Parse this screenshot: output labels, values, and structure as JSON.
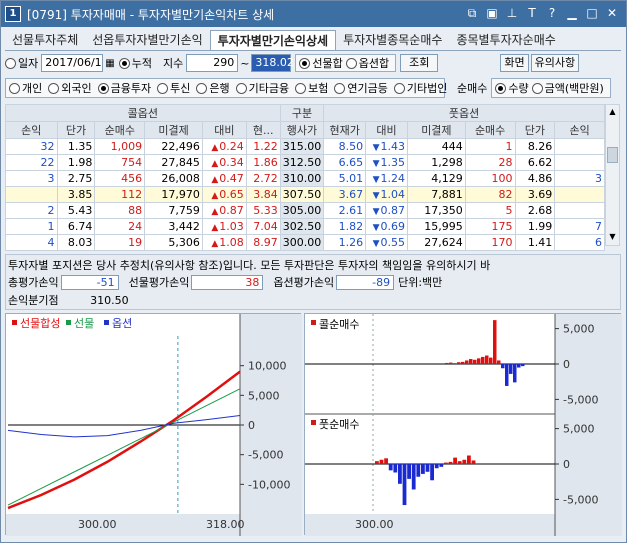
{
  "window": {
    "number": "1",
    "title": "[0791] 투자자매매 - 투자자별만기손익차트 상세"
  },
  "tabs": [
    "선물투자주체",
    "선옵투자자별만기손익",
    "투자자별만기손익상세",
    "투자자별종목순매수",
    "종목별투자자순매수"
  ],
  "active_tab": 2,
  "controls": {
    "date_label": "일자",
    "date_value": "2017/06/1",
    "cum_label": "누적",
    "index_label": "지수",
    "index_from": "290",
    "tilde": "~",
    "index_to": "318.02",
    "opt_sum": "선물합",
    "opt_option": "옵션합",
    "query_button": "조회",
    "screen_button": "화면",
    "caution_button": "유의사항"
  },
  "investors": [
    "개인",
    "외국인",
    "금융투자",
    "투신",
    "은행",
    "기타금융",
    "보험",
    "연기금등",
    "기타법인"
  ],
  "investor_selected": 2,
  "net_buy_label": "순매수",
  "net_options": [
    "수량",
    "금액(백만원)"
  ],
  "table": {
    "group_call": "콜옵션",
    "group_mid": "구분",
    "group_put": "풋옵션",
    "headers": [
      "손익",
      "단가",
      "순매수",
      "미결제",
      "대비",
      "현...",
      "행사가",
      "현재가",
      "대비",
      "미결제",
      "순매수",
      "단가",
      "손익"
    ],
    "rows": [
      {
        "c_pl": "32",
        "c_price": "1.35",
        "c_net": "1,009",
        "c_oi": "22,496",
        "c_chg": "0.24",
        "c_chgdir": "up",
        "c_cur": "1.22",
        "strike": "315.00",
        "p_cur": "8.50",
        "p_chg": "1.43",
        "p_chgdir": "dn",
        "p_oi": "444",
        "p_net": "1",
        "p_price": "8.26",
        "p_pl": ""
      },
      {
        "c_pl": "22",
        "c_price": "1.98",
        "c_net": "754",
        "c_oi": "27,845",
        "c_chg": "0.34",
        "c_chgdir": "up",
        "c_cur": "1.86",
        "strike": "312.50",
        "p_cur": "6.65",
        "p_chg": "1.35",
        "p_chgdir": "dn",
        "p_oi": "1,298",
        "p_net": "28",
        "p_price": "6.62",
        "p_pl": ""
      },
      {
        "c_pl": "3",
        "c_price": "2.75",
        "c_net": "456",
        "c_oi": "26,008",
        "c_chg": "0.47",
        "c_chgdir": "up",
        "c_cur": "2.72",
        "strike": "310.00",
        "p_cur": "5.01",
        "p_chg": "1.24",
        "p_chgdir": "dn",
        "p_oi": "4,129",
        "p_net": "100",
        "p_price": "4.86",
        "p_pl": "3"
      },
      {
        "c_pl": "",
        "c_price": "3.85",
        "c_net": "112",
        "c_oi": "17,970",
        "c_chg": "0.65",
        "c_chgdir": "up",
        "c_cur": "3.84",
        "strike": "307.50",
        "p_cur": "3.67",
        "p_chg": "1.04",
        "p_chgdir": "dn",
        "p_oi": "7,881",
        "p_net": "82",
        "p_price": "3.69",
        "p_pl": "",
        "hl": true
      },
      {
        "c_pl": "2",
        "c_price": "5.43",
        "c_net": "88",
        "c_oi": "7,759",
        "c_chg": "0.87",
        "c_chgdir": "up",
        "c_cur": "5.33",
        "strike": "305.00",
        "p_cur": "2.61",
        "p_chg": "0.87",
        "p_chgdir": "dn",
        "p_oi": "17,350",
        "p_net": "5",
        "p_price": "2.68",
        "p_pl": ""
      },
      {
        "c_pl": "1",
        "c_price": "6.74",
        "c_net": "24",
        "c_oi": "3,442",
        "c_chg": "1.03",
        "c_chgdir": "up",
        "c_cur": "7.04",
        "strike": "302.50",
        "p_cur": "1.82",
        "p_chg": "0.69",
        "p_chgdir": "dn",
        "p_oi": "15,995",
        "p_net": "175",
        "p_price": "1.99",
        "p_pl": "7"
      },
      {
        "c_pl": "4",
        "c_price": "8.03",
        "c_net": "19",
        "c_oi": "5,306",
        "c_chg": "1.08",
        "c_chgdir": "up",
        "c_cur": "8.97",
        "strike": "300.00",
        "p_cur": "1.26",
        "p_chg": "0.55",
        "p_chgdir": "dn",
        "p_oi": "27,624",
        "p_net": "170",
        "p_price": "1.41",
        "p_pl": "6"
      }
    ]
  },
  "info": {
    "notice": "투자자별 포지션은 당사 추정치(유의사항 참조)입니다. 모든 투자판단은 투자자의 책임임을 유의하시기 바",
    "total_label": "총평가손익",
    "total_value": "-51",
    "fut_label": "선물평가손익",
    "fut_value": "38",
    "opt_label": "옵션평가손익",
    "opt_value": "-89",
    "unit_label": "단위:백만",
    "bep_label": "손익분기점",
    "bep_value": "310.50"
  },
  "colors": {
    "fut_sum": "#e01010",
    "fut": "#1a9a4a",
    "opt": "#2233cc",
    "call_pos": "#e01010",
    "neg": "#1a2ad0"
  },
  "chart_data": [
    {
      "type": "line",
      "legend": [
        "선물합성",
        "선물",
        "옵션"
      ],
      "y_ticks": [
        "10,000",
        "5,000",
        "0",
        "-5,000",
        "-10,000"
      ],
      "x_ticks": [
        "300.00",
        "318.00"
      ],
      "x_range": [
        290,
        318
      ],
      "y_range": [
        -15000,
        15000
      ],
      "series": [
        {
          "name": "선물합성",
          "x": [
            290,
            294,
            298,
            302,
            306,
            310,
            314,
            318
          ],
          "values": [
            -14000,
            -11800,
            -9200,
            -6200,
            -2800,
            800,
            4800,
            9000
          ]
        },
        {
          "name": "선물",
          "x": [
            290,
            294,
            298,
            302,
            306,
            310,
            314,
            318
          ],
          "values": [
            -13500,
            -10700,
            -7900,
            -5100,
            -2300,
            500,
            3300,
            6100
          ]
        },
        {
          "name": "옵션",
          "x": [
            290,
            294,
            298,
            302,
            306,
            310,
            314,
            318
          ],
          "values": [
            -900,
            -1600,
            -2000,
            -1800,
            -900,
            300,
            900,
            1600
          ]
        }
      ]
    },
    {
      "type": "bar",
      "legend": [
        "콜순매수"
      ],
      "y_ticks": [
        "5,000",
        "0",
        "-5,000"
      ],
      "y_range": [
        -6500,
        6500
      ],
      "categories": [
        "b1",
        "b2",
        "b3",
        "b4",
        "b5",
        "b6",
        "b7",
        "b8",
        "b9",
        "b10",
        "b11",
        "b12",
        "b13",
        "b14",
        "b15",
        "b16",
        "b17",
        "b18",
        "b19",
        "b20"
      ],
      "values": [
        150,
        200,
        120,
        250,
        300,
        500,
        700,
        600,
        800,
        1000,
        1200,
        900,
        6200,
        500,
        -600,
        -3100,
        -1400,
        -2600,
        -500,
        -300
      ]
    },
    {
      "type": "bar",
      "legend": [
        "풋순매수"
      ],
      "x_ticks": [
        "300.00"
      ],
      "y_ticks": [
        "5,000",
        "0",
        "-5,000"
      ],
      "y_range": [
        -6500,
        6500
      ],
      "categories": [
        "p1",
        "p2",
        "p3",
        "p4",
        "p5",
        "p6",
        "p7",
        "p8",
        "p9",
        "p10",
        "p11",
        "p12",
        "p13",
        "p14",
        "p15",
        "p16",
        "p17",
        "p18",
        "p19",
        "p20",
        "p21",
        "p22"
      ],
      "values": [
        400,
        600,
        800,
        -900,
        -1200,
        -2800,
        -5800,
        -2100,
        -3600,
        -1800,
        -1400,
        -1100,
        -2300,
        -600,
        -400,
        200,
        300,
        900,
        400,
        600,
        1200,
        500
      ]
    }
  ]
}
